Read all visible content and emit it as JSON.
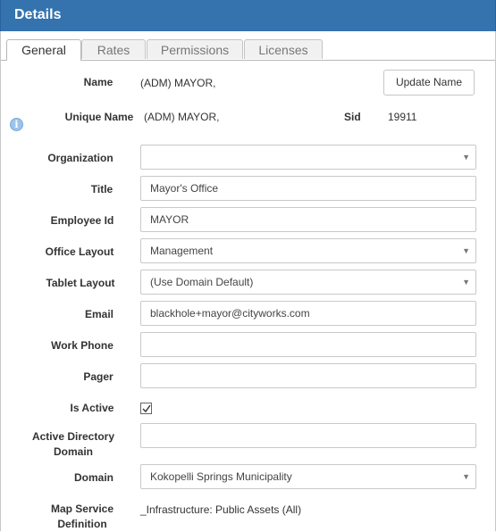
{
  "header": {
    "title": "Details"
  },
  "tabs": [
    {
      "label": "General",
      "active": true
    },
    {
      "label": "Rates",
      "active": false
    },
    {
      "label": "Permissions",
      "active": false
    },
    {
      "label": "Licenses",
      "active": false
    }
  ],
  "form": {
    "name": {
      "label": "Name",
      "value": "(ADM) MAYOR,"
    },
    "update_name_button": "Update Name",
    "unique_name": {
      "label": "Unique Name",
      "value": "(ADM) MAYOR,"
    },
    "sid": {
      "label": "Sid",
      "value": "19911"
    },
    "organization": {
      "label": "Organization",
      "value": ""
    },
    "title": {
      "label": "Title",
      "value": "Mayor's Office"
    },
    "employee_id": {
      "label": "Employee Id",
      "value": "MAYOR"
    },
    "office_layout": {
      "label": "Office Layout",
      "value": "Management"
    },
    "tablet_layout": {
      "label": "Tablet Layout",
      "value": "(Use Domain Default)"
    },
    "email": {
      "label": "Email",
      "value": "blackhole+mayor@cityworks.com"
    },
    "work_phone": {
      "label": "Work Phone",
      "value": ""
    },
    "pager": {
      "label": "Pager",
      "value": ""
    },
    "is_active": {
      "label": "Is Active",
      "checked": true
    },
    "active_directory_domain": {
      "label": "Active Directory Domain",
      "value": ""
    },
    "domain": {
      "label": "Domain",
      "value": "Kokopelli Springs Municipality"
    },
    "map_service_definition": {
      "label": "Map Service Definition",
      "value": "_Infrastructure: Public Assets (All)"
    }
  },
  "icons": {
    "info": "info-icon",
    "select_arrow": "chevron-down-icon",
    "checkmark": "checkmark-icon"
  },
  "colors": {
    "header_bg": "#3473ae",
    "header_text": "#ffffff",
    "info_icon": "#9cc4ea"
  }
}
